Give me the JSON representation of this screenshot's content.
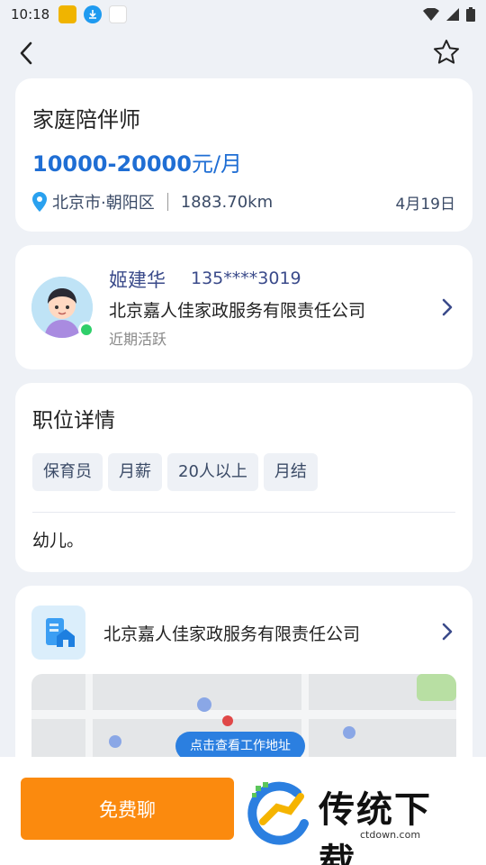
{
  "status_bar": {
    "time": "10:18"
  },
  "job": {
    "title": "家庭陪伴师",
    "salary_range": "10000-20000",
    "salary_unit": "元/月",
    "location": "北京市·朝阳区",
    "distance": "1883.70km",
    "date": "4月19日"
  },
  "recruiter": {
    "name": "姬建华",
    "phone": "135****3019",
    "company": "北京嘉人佳家政服务有限责任公司",
    "status": "近期活跃"
  },
  "details": {
    "title": "职位详情",
    "tags": [
      "保育员",
      "月薪",
      "20人以上",
      "月结"
    ],
    "description": "幼儿。"
  },
  "company": {
    "name": "北京嘉人佳家政服务有限责任公司",
    "map_button": "点击查看工作地址"
  },
  "bottom": {
    "chat_label": "免费聊",
    "watermark_title": "传统下载",
    "watermark_url": "ctdown.com"
  },
  "colors": {
    "accent_blue": "#1f6ed4",
    "chat_orange": "#fb8a0e",
    "online_green": "#2fcf6a"
  }
}
